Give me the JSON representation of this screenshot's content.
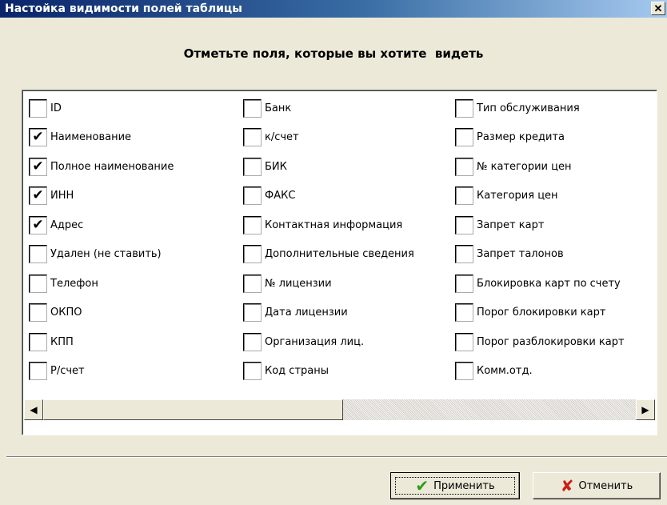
{
  "window": {
    "title": "Настойка видимости полей таблицы",
    "close_glyph": "✕"
  },
  "heading": "Отметьте поля, которые вы хотите  видеть",
  "fields": {
    "column1": [
      {
        "label": "ID",
        "checked": false
      },
      {
        "label": "Наименование",
        "checked": true
      },
      {
        "label": "Полное наименование",
        "checked": true
      },
      {
        "label": "ИНН",
        "checked": true
      },
      {
        "label": "Адрес",
        "checked": true
      },
      {
        "label": "Удален (не ставить)",
        "checked": false
      },
      {
        "label": "Телефон",
        "checked": false
      },
      {
        "label": "ОКПО",
        "checked": false
      },
      {
        "label": "КПП",
        "checked": false
      },
      {
        "label": "Р/счет",
        "checked": false
      }
    ],
    "column2": [
      {
        "label": "Банк",
        "checked": false
      },
      {
        "label": "к/счет",
        "checked": false
      },
      {
        "label": "БИК",
        "checked": false
      },
      {
        "label": "ФАКС",
        "checked": false
      },
      {
        "label": "Контактная информация",
        "checked": false
      },
      {
        "label": "Дополнительные сведения",
        "checked": false
      },
      {
        "label": "№ лицензии",
        "checked": false
      },
      {
        "label": "Дата лицензии",
        "checked": false
      },
      {
        "label": "Организация лиц.",
        "checked": false
      },
      {
        "label": "Код страны",
        "checked": false
      }
    ],
    "column3": [
      {
        "label": "Тип обслуживания",
        "checked": false
      },
      {
        "label": "Размер кредита",
        "checked": false
      },
      {
        "label": "№ категории цен",
        "checked": false
      },
      {
        "label": "Категория цен",
        "checked": false
      },
      {
        "label": "Запрет карт",
        "checked": false
      },
      {
        "label": "Запрет талонов",
        "checked": false
      },
      {
        "label": "Блокировка карт по счету",
        "checked": false
      },
      {
        "label": "Порог блокировки карт",
        "checked": false
      },
      {
        "label": "Порог разблокировки карт",
        "checked": false
      },
      {
        "label": "Комм.отд.",
        "checked": false
      }
    ]
  },
  "scrollbar": {
    "left_arrow": "◀",
    "right_arrow": "▶",
    "position": 0
  },
  "buttons": {
    "apply_label": "Применить",
    "apply_icon": "check-icon",
    "apply_glyph": "✔",
    "cancel_label": "Отменить",
    "cancel_icon": "x-icon",
    "cancel_glyph": "✘"
  },
  "colors": {
    "titlebar_start": "#0a246a",
    "titlebar_end": "#a6caf0",
    "apply_icon": "#2f9c1a",
    "cancel_icon": "#c8201a",
    "dialog_bg": "#ece9d8"
  }
}
